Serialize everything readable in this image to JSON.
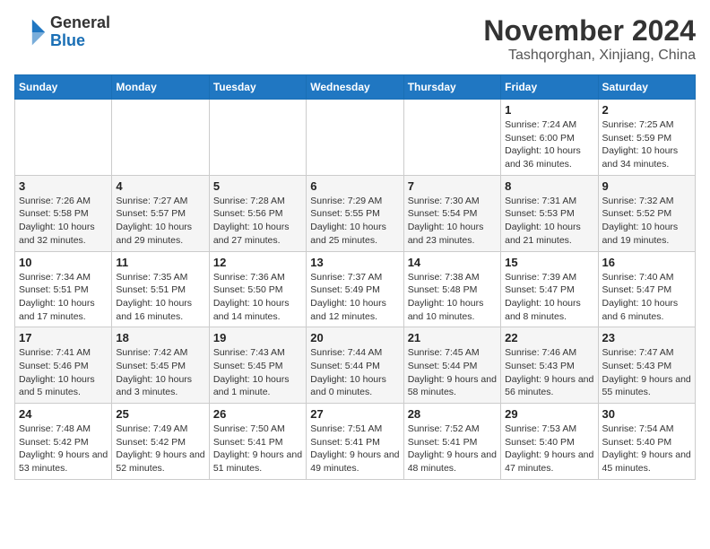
{
  "header": {
    "logo_line1": "General",
    "logo_line2": "Blue",
    "month_year": "November 2024",
    "location": "Tashqorghan, Xinjiang, China"
  },
  "weekdays": [
    "Sunday",
    "Monday",
    "Tuesday",
    "Wednesday",
    "Thursday",
    "Friday",
    "Saturday"
  ],
  "weeks": [
    [
      {
        "day": "",
        "info": ""
      },
      {
        "day": "",
        "info": ""
      },
      {
        "day": "",
        "info": ""
      },
      {
        "day": "",
        "info": ""
      },
      {
        "day": "",
        "info": ""
      },
      {
        "day": "1",
        "info": "Sunrise: 7:24 AM\nSunset: 6:00 PM\nDaylight: 10 hours and 36 minutes."
      },
      {
        "day": "2",
        "info": "Sunrise: 7:25 AM\nSunset: 5:59 PM\nDaylight: 10 hours and 34 minutes."
      }
    ],
    [
      {
        "day": "3",
        "info": "Sunrise: 7:26 AM\nSunset: 5:58 PM\nDaylight: 10 hours and 32 minutes."
      },
      {
        "day": "4",
        "info": "Sunrise: 7:27 AM\nSunset: 5:57 PM\nDaylight: 10 hours and 29 minutes."
      },
      {
        "day": "5",
        "info": "Sunrise: 7:28 AM\nSunset: 5:56 PM\nDaylight: 10 hours and 27 minutes."
      },
      {
        "day": "6",
        "info": "Sunrise: 7:29 AM\nSunset: 5:55 PM\nDaylight: 10 hours and 25 minutes."
      },
      {
        "day": "7",
        "info": "Sunrise: 7:30 AM\nSunset: 5:54 PM\nDaylight: 10 hours and 23 minutes."
      },
      {
        "day": "8",
        "info": "Sunrise: 7:31 AM\nSunset: 5:53 PM\nDaylight: 10 hours and 21 minutes."
      },
      {
        "day": "9",
        "info": "Sunrise: 7:32 AM\nSunset: 5:52 PM\nDaylight: 10 hours and 19 minutes."
      }
    ],
    [
      {
        "day": "10",
        "info": "Sunrise: 7:34 AM\nSunset: 5:51 PM\nDaylight: 10 hours and 17 minutes."
      },
      {
        "day": "11",
        "info": "Sunrise: 7:35 AM\nSunset: 5:51 PM\nDaylight: 10 hours and 16 minutes."
      },
      {
        "day": "12",
        "info": "Sunrise: 7:36 AM\nSunset: 5:50 PM\nDaylight: 10 hours and 14 minutes."
      },
      {
        "day": "13",
        "info": "Sunrise: 7:37 AM\nSunset: 5:49 PM\nDaylight: 10 hours and 12 minutes."
      },
      {
        "day": "14",
        "info": "Sunrise: 7:38 AM\nSunset: 5:48 PM\nDaylight: 10 hours and 10 minutes."
      },
      {
        "day": "15",
        "info": "Sunrise: 7:39 AM\nSunset: 5:47 PM\nDaylight: 10 hours and 8 minutes."
      },
      {
        "day": "16",
        "info": "Sunrise: 7:40 AM\nSunset: 5:47 PM\nDaylight: 10 hours and 6 minutes."
      }
    ],
    [
      {
        "day": "17",
        "info": "Sunrise: 7:41 AM\nSunset: 5:46 PM\nDaylight: 10 hours and 5 minutes."
      },
      {
        "day": "18",
        "info": "Sunrise: 7:42 AM\nSunset: 5:45 PM\nDaylight: 10 hours and 3 minutes."
      },
      {
        "day": "19",
        "info": "Sunrise: 7:43 AM\nSunset: 5:45 PM\nDaylight: 10 hours and 1 minute."
      },
      {
        "day": "20",
        "info": "Sunrise: 7:44 AM\nSunset: 5:44 PM\nDaylight: 10 hours and 0 minutes."
      },
      {
        "day": "21",
        "info": "Sunrise: 7:45 AM\nSunset: 5:44 PM\nDaylight: 9 hours and 58 minutes."
      },
      {
        "day": "22",
        "info": "Sunrise: 7:46 AM\nSunset: 5:43 PM\nDaylight: 9 hours and 56 minutes."
      },
      {
        "day": "23",
        "info": "Sunrise: 7:47 AM\nSunset: 5:43 PM\nDaylight: 9 hours and 55 minutes."
      }
    ],
    [
      {
        "day": "24",
        "info": "Sunrise: 7:48 AM\nSunset: 5:42 PM\nDaylight: 9 hours and 53 minutes."
      },
      {
        "day": "25",
        "info": "Sunrise: 7:49 AM\nSunset: 5:42 PM\nDaylight: 9 hours and 52 minutes."
      },
      {
        "day": "26",
        "info": "Sunrise: 7:50 AM\nSunset: 5:41 PM\nDaylight: 9 hours and 51 minutes."
      },
      {
        "day": "27",
        "info": "Sunrise: 7:51 AM\nSunset: 5:41 PM\nDaylight: 9 hours and 49 minutes."
      },
      {
        "day": "28",
        "info": "Sunrise: 7:52 AM\nSunset: 5:41 PM\nDaylight: 9 hours and 48 minutes."
      },
      {
        "day": "29",
        "info": "Sunrise: 7:53 AM\nSunset: 5:40 PM\nDaylight: 9 hours and 47 minutes."
      },
      {
        "day": "30",
        "info": "Sunrise: 7:54 AM\nSunset: 5:40 PM\nDaylight: 9 hours and 45 minutes."
      }
    ]
  ]
}
